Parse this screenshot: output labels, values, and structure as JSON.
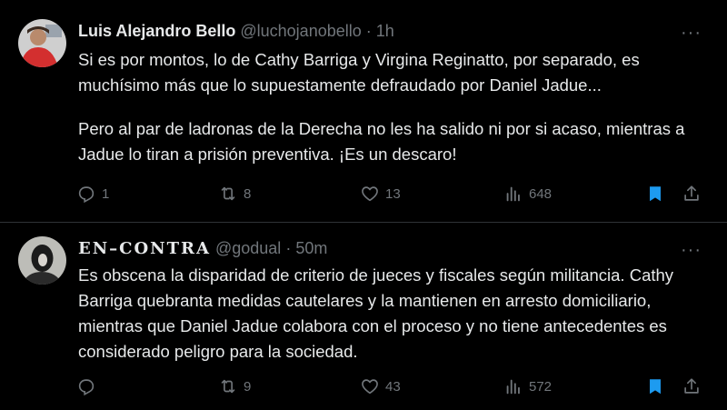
{
  "tweets": [
    {
      "name": "Luis Alejandro Bello",
      "handle": "@luchojanobello",
      "separator": "·",
      "time": "1h",
      "more": "···",
      "body": [
        "Si es por montos, lo de Cathy Barriga y Virgina Reginatto, por separado, es muchísimo más que lo supuestamente defraudado por Daniel Jadue...",
        "Pero al par de ladronas de la Derecha no les ha salido ni por si acaso, mientras a Jadue lo tiran a prisión preventiva. ¡Es un descaro!"
      ],
      "stats": {
        "replies": "1",
        "retweets": "8",
        "likes": "13",
        "views": "648"
      },
      "bookmarked": true
    },
    {
      "name": "EN–CONTRA",
      "handle": "@godual",
      "separator": "·",
      "time": "50m",
      "more": "···",
      "body": [
        "Es obscena la disparidad de criterio de jueces y fiscales según militancia. Cathy Barriga quebranta medidas cautelares y la mantienen en arresto domiciliario, mientras que Daniel Jadue colabora con el proceso y no tiene antecedentes es considerado peligro para la sociedad."
      ],
      "stats": {
        "replies": "",
        "retweets": "9",
        "likes": "43",
        "views": "572"
      },
      "bookmarked": true
    }
  ],
  "colors": {
    "background": "#000000",
    "text": "#e7e9ea",
    "muted": "#71767b",
    "accent": "#1d9bf0",
    "divider": "#2f3336"
  },
  "icons": [
    "reply-icon",
    "retweet-icon",
    "like-icon",
    "views-icon",
    "bookmark-icon",
    "share-icon",
    "more-icon"
  ]
}
